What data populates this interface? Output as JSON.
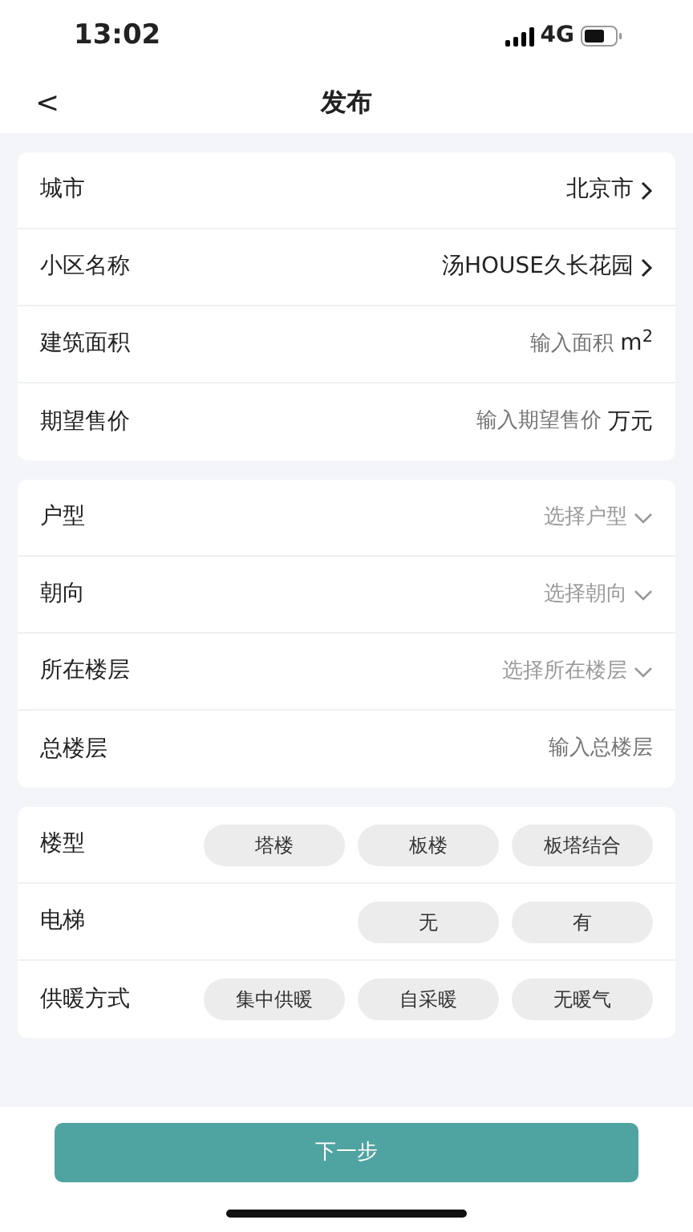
{
  "status_bar": {
    "time": "13:02",
    "network": "4G"
  },
  "nav": {
    "back": "<",
    "title": "发布"
  },
  "sections": [
    {
      "rows": [
        {
          "kind": "link",
          "label": "城市",
          "value": "北京市"
        },
        {
          "kind": "link",
          "label": "小区名称",
          "value": "汤HOUSE久长花园"
        },
        {
          "kind": "input",
          "label": "建筑面积",
          "placeholder": "输入面积",
          "unit": "m$^{2}$"
        },
        {
          "kind": "input",
          "label": "期望售价",
          "placeholder": "输入期望售价",
          "unit": "万元"
        }
      ]
    },
    {
      "rows": [
        {
          "kind": "select",
          "label": "户型",
          "placeholder": "选择户型"
        },
        {
          "kind": "select",
          "label": "朝向",
          "placeholder": "选择朝向"
        },
        {
          "kind": "select",
          "label": "所在楼层",
          "placeholder": "选择所在楼层"
        },
        {
          "kind": "input",
          "label": "总楼层",
          "placeholder": "输入总楼层"
        }
      ]
    },
    {
      "rows": [
        {
          "kind": "options",
          "label": "楼型",
          "options": [
            {
              "label": "塔楼",
              "selected": false
            },
            {
              "label": "板楼",
              "selected": false
            },
            {
              "label": "板塔结合",
              "selected": false
            }
          ]
        },
        {
          "kind": "options",
          "label": "电梯",
          "options": [
            {
              "label": "无",
              "selected": false
            },
            {
              "label": "有",
              "selected": false
            }
          ]
        },
        {
          "kind": "options",
          "label": "供暖方式",
          "options": [
            {
              "label": "集中供暖",
              "selected": false
            },
            {
              "label": "自采暖",
              "selected": false
            },
            {
              "label": "无暖气",
              "selected": false
            }
          ]
        }
      ]
    }
  ],
  "next_button": "下一步"
}
